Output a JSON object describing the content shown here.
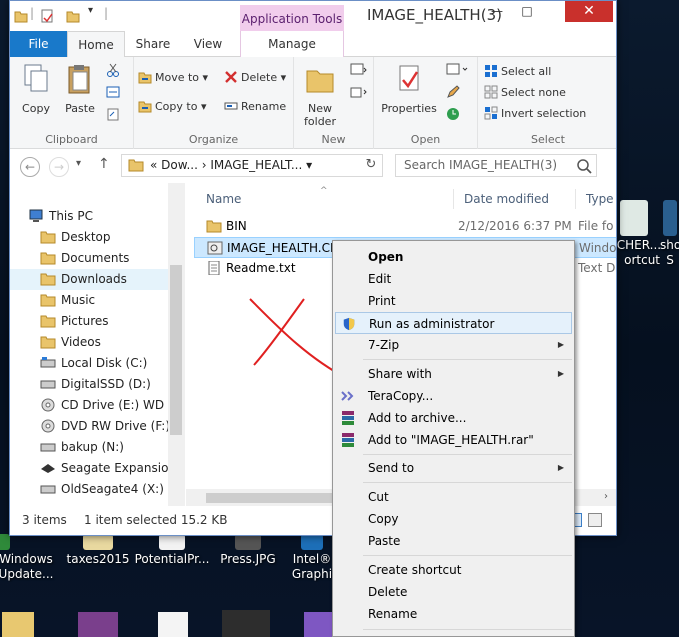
{
  "window": {
    "title": "IMAGE_HEALTH(3)",
    "app_tools_tab": "Application Tools",
    "min": "—",
    "max": "□",
    "close": "✕"
  },
  "ribbon_tabs": {
    "file": "File",
    "home": "Home",
    "share": "Share",
    "view": "View",
    "manage": "Manage"
  },
  "ribbon": {
    "clipboard": {
      "label": "Clipboard",
      "copy": "Copy",
      "paste": "Paste"
    },
    "organize": {
      "label": "Organize",
      "move_to": "Move to ▾",
      "copy_to": "Copy to ▾",
      "delete": "Delete ▾",
      "rename": "Rename"
    },
    "new": {
      "label": "New",
      "new_folder_1": "New",
      "new_folder_2": "folder"
    },
    "open": {
      "label": "Open",
      "properties": "Properties"
    },
    "select": {
      "label": "Select",
      "select_all": "Select all",
      "select_none": "Select none",
      "invert": "Invert selection"
    }
  },
  "address": {
    "back": "←",
    "forward": "→",
    "recent": "▾",
    "up": "↑",
    "path": "«  Dow...  ›  IMAGE_HEALT...  ▾",
    "refresh": "↻",
    "search_placeholder": "Search IMAGE_HEALTH(3)"
  },
  "nav_pane": {
    "items": [
      {
        "label": "This PC",
        "icon": "pc-icon"
      },
      {
        "label": "Desktop",
        "icon": "folder-icon"
      },
      {
        "label": "Documents",
        "icon": "folder-icon"
      },
      {
        "label": "Downloads",
        "icon": "folder-icon"
      },
      {
        "label": "Music",
        "icon": "folder-icon"
      },
      {
        "label": "Pictures",
        "icon": "folder-icon"
      },
      {
        "label": "Videos",
        "icon": "folder-icon"
      },
      {
        "label": "Local Disk (C:)",
        "icon": "drive-icon"
      },
      {
        "label": "DigitalSSD (D:)",
        "icon": "drive-icon"
      },
      {
        "label": "CD Drive (E:) WD S",
        "icon": "cd-icon"
      },
      {
        "label": "DVD RW Drive (F:) ",
        "icon": "dvd-icon"
      },
      {
        "label": "bakup (N:)",
        "icon": "drive-icon"
      },
      {
        "label": "Seagate Expansion",
        "icon": "drive-icon"
      },
      {
        "label": "OldSeagate4 (X:)",
        "icon": "drive-icon"
      }
    ]
  },
  "columns": {
    "name": "Name",
    "date": "Date modified",
    "type": "Type"
  },
  "files": [
    {
      "name": "BIN",
      "date": "2/12/2016 6:37 PM",
      "type": "File fo"
    },
    {
      "name": "IMAGE_HEALTH.CMD",
      "date": "",
      "type": "Windo"
    },
    {
      "name": "Readme.txt",
      "date": "",
      "type": "Text D"
    }
  ],
  "status": {
    "items": "3 items",
    "selected": "1 item selected  15.2 KB"
  },
  "context_menu": {
    "open": "Open",
    "edit": "Edit",
    "print": "Print",
    "run_admin": "Run as administrator",
    "seven_zip": "7-Zip",
    "share_with": "Share with",
    "teracopy": "TeraCopy...",
    "add_archive": "Add to archive...",
    "add_rar": "Add to \"IMAGE_HEALTH.rar\"",
    "send_to": "Send to",
    "cut": "Cut",
    "copy": "Copy",
    "paste": "Paste",
    "create_shortcut": "Create shortcut",
    "delete": "Delete",
    "rename": "Rename",
    "submenu_arrow": "▶"
  },
  "desktop": {
    "icons": [
      {
        "label1": "Windows",
        "label2": "Update..."
      },
      {
        "label1": "taxes2015",
        "label2": ""
      },
      {
        "label1": "PotentialPr...",
        "label2": ""
      },
      {
        "label1": "Press.JPG",
        "label2": ""
      },
      {
        "label1": "Intel®",
        "label2": "Graphi"
      },
      {
        "label1": "UCHER...",
        "label2": "ortcut"
      },
      {
        "label1": "sho",
        "label2": "S"
      }
    ]
  }
}
